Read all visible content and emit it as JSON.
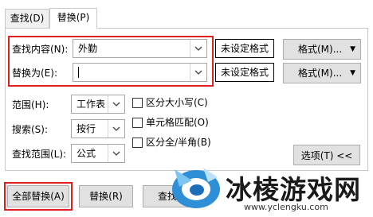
{
  "tabs": [
    {
      "label": "查找(D)"
    },
    {
      "label": "替换(P)"
    }
  ],
  "find": {
    "label": "查找内容(N):",
    "value": "外勤",
    "format_status": "未设定格式",
    "format_button": "格式(M)..."
  },
  "replace": {
    "label": "替换为(E):",
    "value": "",
    "format_status": "未设定格式",
    "format_button": "格式(M)..."
  },
  "options": {
    "scope": {
      "label": "范围(H):",
      "value": "工作表"
    },
    "search": {
      "label": "搜索(S):",
      "value": "按行"
    },
    "look_in": {
      "label": "查找范围(L):",
      "value": "公式"
    },
    "checkboxes": [
      {
        "label": "区分大小写(C)",
        "checked": false
      },
      {
        "label": "单元格匹配(O)",
        "checked": false
      },
      {
        "label": "区分全/半角(B)",
        "checked": false
      }
    ],
    "options_button": "选项(T) <<"
  },
  "footer": {
    "replace_all": "全部替换(A)",
    "replace": "替换(R)",
    "find_all_partial": "查找"
  },
  "watermark": {
    "brand_text": "冰棱游戏网",
    "url": "www.yclengku.com"
  }
}
